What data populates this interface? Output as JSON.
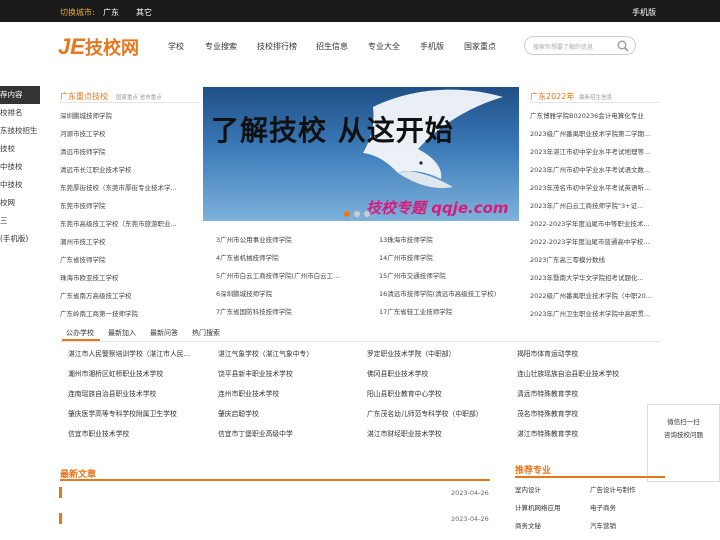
{
  "topbar": {
    "switch_label": "切换城市:",
    "city1": "广东",
    "city2": "其它",
    "mobile": "手机版"
  },
  "logo": {
    "text": "JE技校网"
  },
  "nav": [
    "学校",
    "专业搜索",
    "技校排行榜",
    "招生信息",
    "专业大全",
    "手机版",
    "国家重点"
  ],
  "search": {
    "placeholder": "搜索你想要了解的信息"
  },
  "left_menu": [
    "荐内容",
    "校排名",
    "东技校招生",
    "技校",
    "中技校",
    "中技校",
    "校网",
    "三",
    "(手机版)"
  ],
  "key_schools": {
    "title": "广东重点技校",
    "subtitle": "国家重点 省市重点",
    "items": [
      "深圳鹏城技师学院",
      "河源市技工学校",
      "清远市技师学院",
      "清远市长江职业技术学校",
      "东莞厚街技校（东莞市厚街专业技术学...",
      "东莞市技师学院",
      "东莞市高级技工学校（东莞市旅游职业...",
      "潮州市技工学校",
      "广东省技师学院",
      "珠海市欧亚技工学校",
      "广东省南方高级技工学校",
      "广东岭南工商第一技师学院"
    ]
  },
  "banner": {
    "headline": "了解技校  从这开始",
    "footer": "技校专题 qqje.com"
  },
  "mid_list": {
    "col1": [
      "3广州市公用事业技师学院",
      "4广东省机械技师学院",
      "5广州市白云工商技师学院(广州市白云工...",
      "6深圳鹏城技师学院",
      "7广东省国防科技技师学院"
    ],
    "col2": [
      "13珠海市技师学院",
      "14广州市技师学院",
      "15广州市交通技师学院",
      "16清远市技师学院(清远市高级技工学校)",
      "17广东省轻工业技师学院"
    ]
  },
  "news2022": {
    "title": "广东2022年",
    "subtitle": "最新招生信息",
    "items": [
      "广东博雅学院B020236会计电算化专业",
      "2023级广州番禺职业技术学院第二学期...",
      "2023年湛江市初中学业水平考试地理等...",
      "2023年广州市初中学业水平考试语文数...",
      "2023年茂名市初中学业水平考试英语听...",
      "2023年广州白云工商技师学院\"3+证...",
      "2022-2023学年度汕尾市中等职业技术...",
      "2022-2023学年度汕尾市普通高中学校...",
      "2023广东高三零模分数线",
      "2023年暨南大学华文学院招考试题化...",
      "2022级广州番禺职业技术学院（中职20...",
      "2023年广州卫生职业技术学院中高职贯..."
    ]
  },
  "tabs": [
    "公办学校",
    "最新加入",
    "最新问答",
    "热门搜索"
  ],
  "grid": [
    [
      "湛江市人民警察培训学校（湛江市人民...",
      "湛江气象学校（湛江气象中专）",
      "罗定职业技术学院（中职部）",
      "揭阳市体育运动学校"
    ],
    [
      "潮州市湘桥区虹桥职业技术学校",
      "饶平县新丰职业技术学校",
      "佛冈县职业技术学校",
      "连山壮族瑶族自治县职业技术学校"
    ],
    [
      "连南瑶族自治县职业技术学校",
      "连州市职业技术学校",
      "阳山县职业教育中心学校",
      "清远市特殊教育学校"
    ],
    [
      "肇庆医学高等专科学校附属卫生学校",
      "肇庆启聪学校",
      "广东茂名幼儿师范专科学校（中职部）",
      "茂名市特殊教育学校"
    ],
    [
      "信宜市职业技术学校",
      "信宜市丁堡职业高级中学",
      "湛江市财经职业技术学校",
      "湛江市特殊教育学校"
    ]
  ],
  "wechat": {
    "line1": "微信扫一扫",
    "line2": "咨询技校问题"
  },
  "latest": {
    "title": "最新文章",
    "dates": [
      "2023-04-26",
      "2023-04-26"
    ]
  },
  "recommend": {
    "title": "推荐专业",
    "items": [
      [
        "室内设计",
        "广告设计与制作"
      ],
      [
        "计算机网络应用",
        "电子商务"
      ],
      [
        "商务文秘",
        "汽车营销"
      ]
    ]
  },
  "colors": {
    "accent": "#e8761c",
    "topbar": "#1a1a1a"
  }
}
